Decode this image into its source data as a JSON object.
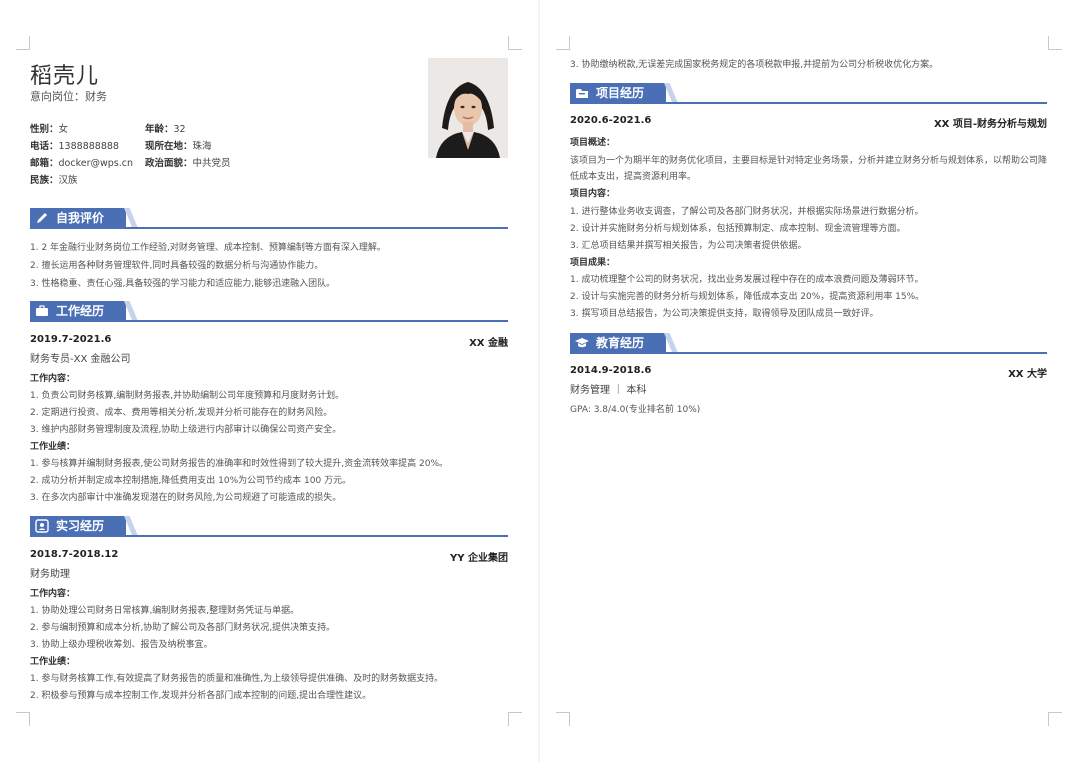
{
  "profile": {
    "name": "稻壳儿",
    "intent_label": "意向岗位：",
    "intent_value": "财务",
    "gender_label": "性别：",
    "gender": "女",
    "age_label": "年龄：",
    "age": "32",
    "phone_label": "电话：",
    "phone": "1388888888",
    "location_label": "现所在地：",
    "location": "珠海",
    "email_label": "邮箱：",
    "email": "docker@wps.cn",
    "politics_label": "政治面貌：",
    "politics": "中共党员",
    "ethnic_label": "民族：",
    "ethnic": "汉族"
  },
  "self_eval": {
    "title": "自我评价",
    "items": [
      "1. 2 年金融行业财务岗位工作经验,对财务管理、成本控制、预算编制等方面有深入理解。",
      "2. 擅长运用各种财务管理软件,同时具备较强的数据分析与沟通协作能力。",
      "3. 性格稳重、责任心强,具备较强的学习能力和适应能力,能够迅速融入团队。"
    ]
  },
  "work": {
    "title": "工作经历",
    "period": "2019.7-2021.6",
    "company": "XX 金融",
    "role": "财务专员-XX 金融公司",
    "content_label": "工作内容：",
    "content": [
      "1. 负责公司财务核算,编制财务报表,并协助编制公司年度预算和月度财务计划。",
      "2. 定期进行投资、成本、费用等相关分析,发现并分析可能存在的财务风险。",
      "3. 维护内部财务管理制度及流程,协助上级进行内部审计以确保公司资产安全。"
    ],
    "result_label": "工作业绩：",
    "results": [
      "1. 参与核算并编制财务报表,使公司财务报告的准确率和时效性得到了较大提升,资金流转效率提高 20%。",
      "2. 成功分析并制定成本控制措施,降低费用支出 10%为公司节约成本 100 万元。",
      "3. 在多次内部审计中准确发现潜在的财务风险,为公司规避了可能造成的损失。"
    ]
  },
  "intern": {
    "title": "实习经历",
    "period": "2018.7-2018.12",
    "company": "YY 企业集团",
    "role": "财务助理",
    "content_label": "工作内容：",
    "content": [
      "1. 协助处理公司财务日常核算,编制财务报表,整理财务凭证与单据。",
      "2. 参与编制预算和成本分析,协助了解公司及各部门财务状况,提供决策支持。",
      "3. 协助上级办理税收筹划、报告及纳税事宜。"
    ],
    "result_label": "工作业绩：",
    "results": [
      "1. 参与财务核算工作,有效提高了财务报告的质量和准确性,为上级领导提供准确、及时的财务数据支持。",
      "2. 积极参与预算与成本控制工作,发现并分析各部门成本控制的问题,提出合理性建议。"
    ],
    "overflow": "3. 协助缴纳税款,无误差完成国家税务规定的各项税款申报,并提前为公司分析税收优化方案。"
  },
  "project": {
    "title": "项目经历",
    "period": "2020.6-2021.6",
    "name": "XX 项目-财务分析与规划",
    "overview_label": "项目概述：",
    "overview_line1": "该项目为一个为期半年的财务优化项目，主要目标是针对特定业务场景，分析并建立财务分析与规划体系，以帮助公司降",
    "overview_line2": "低成本支出，提高资源利用率。",
    "content_label": "项目内容：",
    "content": [
      "1. 进行整体业务收支调查，了解公司及各部门财务状况，并根据实际场景进行数据分析。",
      "2. 设计并实施财务分析与规划体系，包括预算制定、成本控制、现金流管理等方面。",
      "3. 汇总项目结果并撰写相关报告，为公司决策者提供依据。"
    ],
    "result_label": "项目成果：",
    "results": [
      "1. 成功梳理整个公司的财务状况，找出业务发展过程中存在的成本浪费问题及薄弱环节。",
      "2. 设计与实施完善的财务分析与规划体系，降低成本支出 20%，提高资源利用率 15%。",
      "3. 撰写项目总结报告，为公司决策提供支持，取得领导及团队成员一致好评。"
    ]
  },
  "education": {
    "title": "教育经历",
    "period": "2014.9-2018.6",
    "school": "XX 大学",
    "major": "财务管理 ｜ 本科",
    "gpa": "GPA: 3.8/4.0(专业排名前 10%)"
  },
  "colors": {
    "accent": "#4a6fb5",
    "accent_light": "#c7d3ee"
  },
  "icons": [
    "pen-icon",
    "briefcase-icon",
    "id-card-icon",
    "folder-icon",
    "graduation-cap-icon"
  ]
}
